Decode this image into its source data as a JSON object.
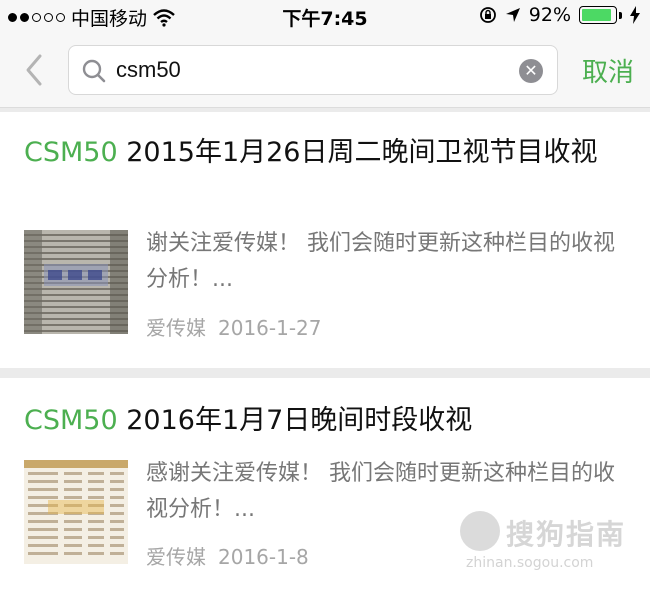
{
  "status_bar": {
    "carrier": "中国移动",
    "time": "下午7:45",
    "battery_percent": "92%",
    "battery_level": 0.92,
    "signal_dots_filled": 2,
    "signal_dots_total": 5,
    "icons": [
      "wifi-icon",
      "rotation-lock-icon",
      "location-arrow-icon",
      "battery-icon",
      "charging-bolt-icon"
    ]
  },
  "search": {
    "query": "csm50",
    "cancel_label": "取消",
    "icons": [
      "back-chevron-icon",
      "search-icon",
      "clear-icon"
    ]
  },
  "results": [
    {
      "highlight": "CSM50",
      "title_rest": " 2015年1月26日周二晚间卫视节目收视",
      "snippet": "谢关注爱传媒！ 我们会随时更新这种栏目的收视分析！...",
      "source": "爱传媒",
      "date": "2016-1-27"
    },
    {
      "highlight": "CSM50",
      "title_rest": " 2016年1月7日晚间时段收视",
      "snippet": "感谢关注爱传媒！ 我们会随时更新这种栏目的收视分析！...",
      "source": "爱传媒",
      "date": "2016-1-8"
    }
  ],
  "watermark": {
    "text": "搜狗指南",
    "url": "zhinan.sogou.com"
  },
  "colors": {
    "accent_green": "#4caf50",
    "battery_green": "#4cd964",
    "snippet_gray": "#777777",
    "meta_gray": "#a6a6a6"
  }
}
